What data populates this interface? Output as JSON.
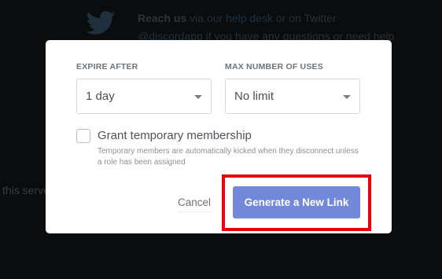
{
  "background": {
    "reach_prefix": "Reach us",
    "reach_via": " via ",
    "help_desk": "our help desk",
    "or_twitter": " or on Twitter",
    "twitter_handle": "@discordapp",
    "twitter_suffix": " if you have any questions or need help",
    "server_fragment": "this serve"
  },
  "modal": {
    "expire": {
      "label": "EXPIRE AFTER",
      "selected": "1 day"
    },
    "max_uses": {
      "label": "MAX NUMBER OF USES",
      "selected": "No limit"
    },
    "temporary": {
      "label": "Grant temporary membership",
      "checked": false,
      "helper": "Temporary members are automatically kicked when they disconnect unless a role has been assigned"
    },
    "cancel_label": "Cancel",
    "generate_label": "Generate a New Link"
  },
  "colors": {
    "accent": "#7289da",
    "highlight": "#e8000b"
  },
  "icons": {
    "background_icon": "twitter-icon",
    "select_caret": "chevron-down-icon"
  }
}
